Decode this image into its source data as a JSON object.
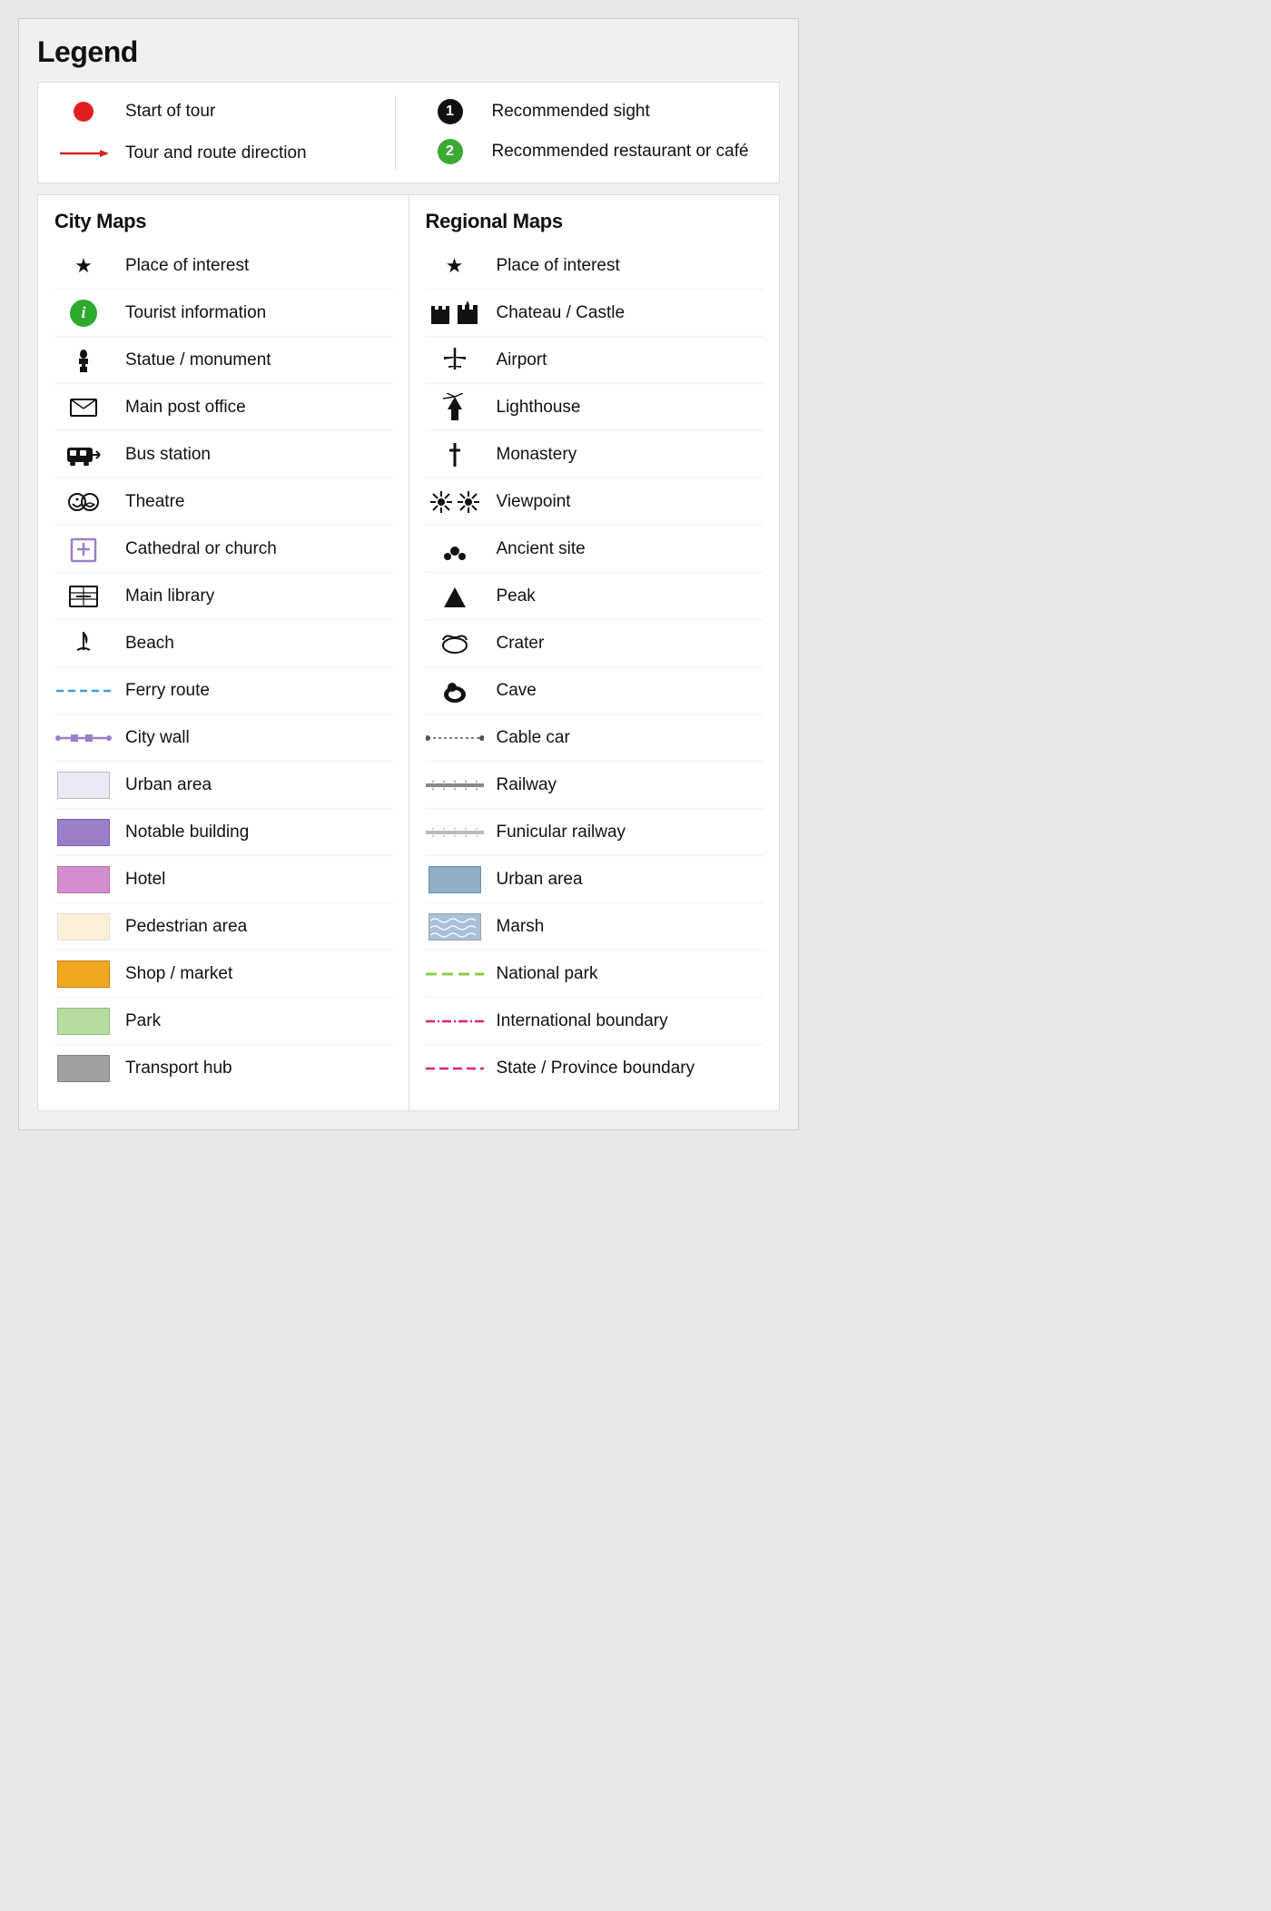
{
  "title": "Legend",
  "top": {
    "left": [
      {
        "id": "start-tour",
        "label": "Start of tour"
      },
      {
        "id": "tour-direction",
        "label": "Tour and route direction"
      }
    ],
    "right": [
      {
        "id": "recommended-sight",
        "number": "1",
        "label": "Recommended sight"
      },
      {
        "id": "recommended-restaurant",
        "number": "2",
        "label": "Recommended restaurant or café"
      }
    ]
  },
  "city_maps": {
    "header": "City Maps",
    "items": [
      {
        "id": "place-of-interest-city",
        "label": "Place of interest"
      },
      {
        "id": "tourist-info",
        "label": "Tourist information"
      },
      {
        "id": "statue-monument",
        "label": "Statue / monument"
      },
      {
        "id": "main-post-office",
        "label": "Main post office"
      },
      {
        "id": "bus-station",
        "label": "Bus station"
      },
      {
        "id": "theatre",
        "label": "Theatre"
      },
      {
        "id": "cathedral-church",
        "label": "Cathedral or church"
      },
      {
        "id": "main-library",
        "label": "Main library"
      },
      {
        "id": "beach",
        "label": "Beach"
      },
      {
        "id": "ferry-route",
        "label": "Ferry route"
      },
      {
        "id": "city-wall",
        "label": "City wall"
      },
      {
        "id": "urban-area-city",
        "label": "Urban area",
        "color": "#ede8f5"
      },
      {
        "id": "notable-building",
        "label": "Notable building",
        "color": "#9b7ec8"
      },
      {
        "id": "hotel",
        "label": "Hotel",
        "color": "#d48ecf"
      },
      {
        "id": "pedestrian-area",
        "label": "Pedestrian area",
        "color": "#fdf0d8"
      },
      {
        "id": "shop-market",
        "label": "Shop / market",
        "color": "#f0a820"
      },
      {
        "id": "park",
        "label": "Park",
        "color": "#b8dba0"
      },
      {
        "id": "transport-hub",
        "label": "Transport hub",
        "color": "#a0a0a0"
      }
    ]
  },
  "regional_maps": {
    "header": "Regional Maps",
    "items": [
      {
        "id": "place-of-interest-reg",
        "label": "Place of interest"
      },
      {
        "id": "chateau-castle",
        "label": "Chateau / Castle"
      },
      {
        "id": "airport",
        "label": "Airport"
      },
      {
        "id": "lighthouse",
        "label": "Lighthouse"
      },
      {
        "id": "monastery",
        "label": "Monastery"
      },
      {
        "id": "viewpoint",
        "label": "Viewpoint"
      },
      {
        "id": "ancient-site",
        "label": "Ancient site"
      },
      {
        "id": "peak",
        "label": "Peak"
      },
      {
        "id": "crater",
        "label": "Crater"
      },
      {
        "id": "cave",
        "label": "Cave"
      },
      {
        "id": "cable-car",
        "label": "Cable car"
      },
      {
        "id": "railway",
        "label": "Railway"
      },
      {
        "id": "funicular-railway",
        "label": "Funicular railway"
      },
      {
        "id": "urban-area-reg",
        "label": "Urban area",
        "color": "#8fafc8"
      },
      {
        "id": "marsh",
        "label": "Marsh"
      },
      {
        "id": "national-park",
        "label": "National park"
      },
      {
        "id": "international-boundary",
        "label": "International boundary"
      },
      {
        "id": "state-province-boundary",
        "label": "State / Province boundary"
      }
    ]
  }
}
